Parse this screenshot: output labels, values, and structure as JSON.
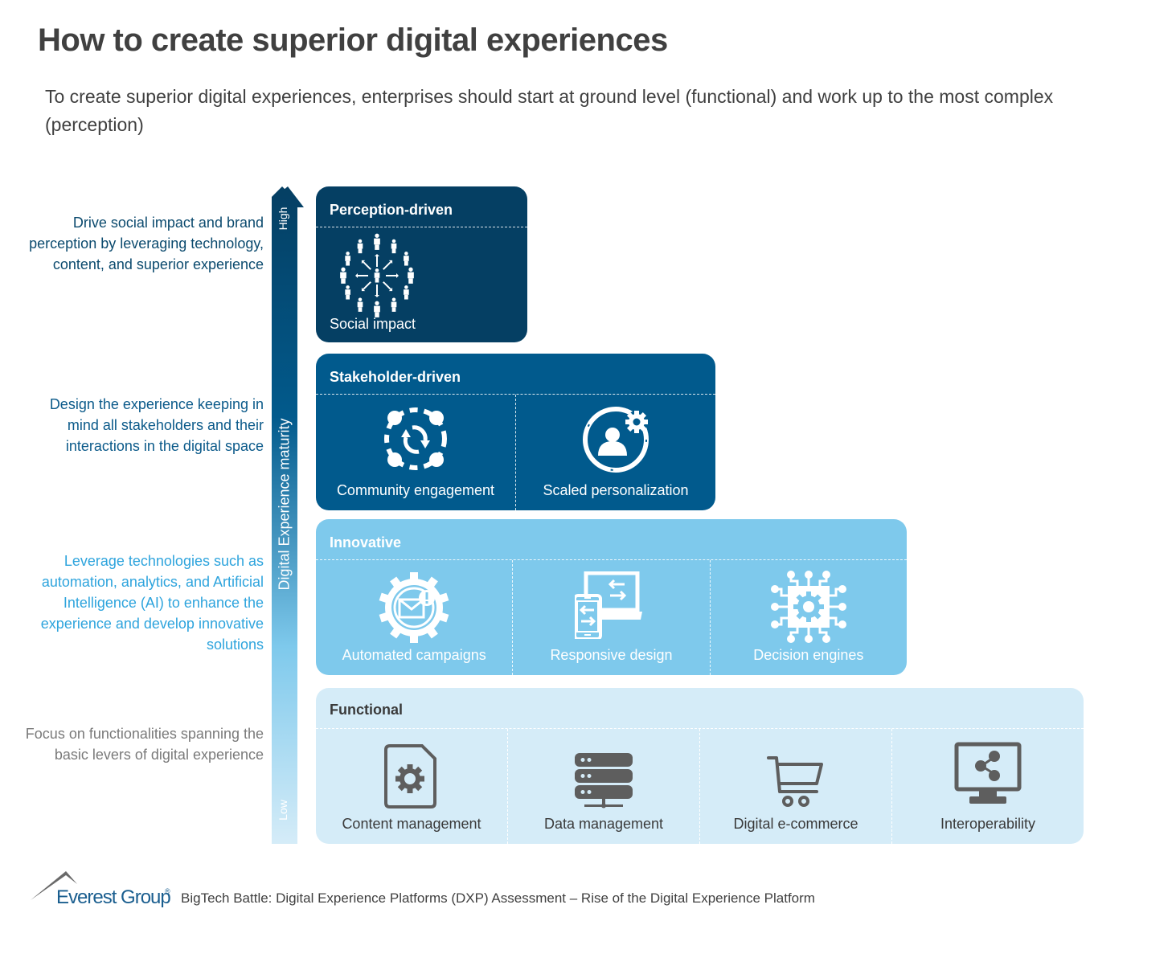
{
  "header": {
    "title": "How to create superior digital experiences",
    "subtitle": "To create superior digital experiences, enterprises should start at ground level (functional) and work up to the most complex (perception)"
  },
  "axis": {
    "title": "Digital Experience maturity",
    "high_label": "High",
    "low_label": "Low",
    "colors": {
      "top": "#053f63",
      "bottom": "#d5ecf8"
    }
  },
  "levels": [
    {
      "name": "Perception-driven",
      "description": "Drive social impact and brand perception by leveraging technology, content, and superior experience",
      "color": "#053f63",
      "items": [
        {
          "label": "Social impact",
          "icon": "social-impact-icon"
        }
      ]
    },
    {
      "name": "Stakeholder-driven",
      "description": "Design the experience keeping in mind all stakeholders and their interactions in the digital space",
      "color": "#015a8d",
      "items": [
        {
          "label": "Community engagement",
          "icon": "community-engagement-icon"
        },
        {
          "label": "Scaled personalization",
          "icon": "scaled-personalization-icon"
        }
      ]
    },
    {
      "name": "Innovative",
      "description": "Leverage technologies such as automation, analytics, and Artificial Intelligence (AI) to enhance the experience and develop innovative solutions",
      "color": "#7ec9ec",
      "items": [
        {
          "label": "Automated campaigns",
          "icon": "automated-campaigns-icon"
        },
        {
          "label": "Responsive design",
          "icon": "responsive-design-icon"
        },
        {
          "label": "Decision engines",
          "icon": "decision-engine-icon"
        }
      ]
    },
    {
      "name": "Functional",
      "description": "Focus on functionalities spanning the basic levers of digital experience",
      "color": "#d5ecf8",
      "items": [
        {
          "label": "Content management",
          "icon": "content-management-icon"
        },
        {
          "label": "Data management",
          "icon": "data-management-icon"
        },
        {
          "label": "Digital e-commerce",
          "icon": "shopping-cart-icon"
        },
        {
          "label": "Interoperability",
          "icon": "interoperability-icon"
        }
      ]
    }
  ],
  "footer": {
    "brand": "Everest Group",
    "registered": "®",
    "source": "BigTech Battle: Digital Experience Platforms (DXP) Assessment – Rise of the Digital Experience Platform"
  }
}
